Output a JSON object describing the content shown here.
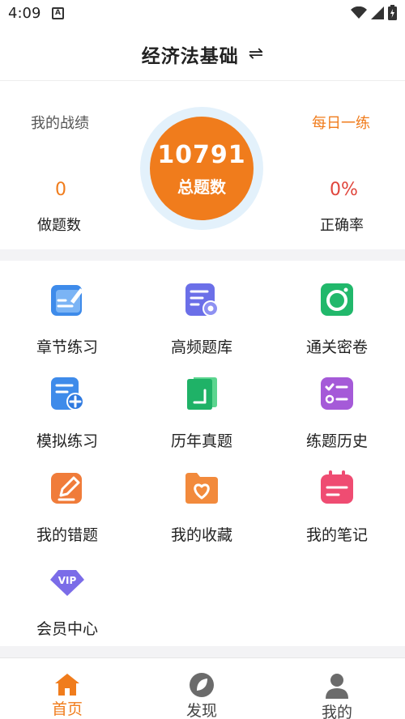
{
  "status_bar": {
    "time": "4:09",
    "notification_badge": "A"
  },
  "header": {
    "title": "经济法基础",
    "switch_icon": "⇌"
  },
  "stats": {
    "my_record_label": "我的战绩",
    "daily_practice_label": "每日一练",
    "total_questions": "10791",
    "total_questions_label": "总题数",
    "done_count": "0",
    "done_label": "做题数",
    "accuracy": "0%",
    "accuracy_label": "正确率"
  },
  "menu": [
    {
      "label": "章节练习",
      "icon": "chapter-practice-icon"
    },
    {
      "label": "高频题库",
      "icon": "high-frequency-icon"
    },
    {
      "label": "通关密卷",
      "icon": "secret-paper-icon"
    },
    {
      "label": "模拟练习",
      "icon": "mock-practice-icon"
    },
    {
      "label": "历年真题",
      "icon": "past-exams-icon"
    },
    {
      "label": "练题历史",
      "icon": "practice-history-icon"
    },
    {
      "label": "我的错题",
      "icon": "wrong-questions-icon"
    },
    {
      "label": "我的收藏",
      "icon": "favorites-icon"
    },
    {
      "label": "我的笔记",
      "icon": "notes-icon"
    },
    {
      "label": "会员中心",
      "icon": "vip-icon"
    }
  ],
  "tabs": [
    {
      "label": "首页",
      "icon": "home-icon",
      "active": true
    },
    {
      "label": "发现",
      "icon": "discover-icon",
      "active": false
    },
    {
      "label": "我的",
      "icon": "profile-icon",
      "active": false
    }
  ],
  "colors": {
    "accent": "#f07c1c",
    "accuracy": "#e0453c",
    "muted": "#555555",
    "tab_inactive": "#444444"
  }
}
